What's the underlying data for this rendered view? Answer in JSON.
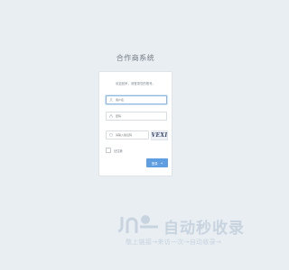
{
  "app": {
    "title": "合作商系统"
  },
  "login": {
    "welcome": "欢迎回来，请登录您的账号。",
    "username_placeholder": "用户名",
    "password_placeholder": "密码",
    "captcha_placeholder": "请输入验证码",
    "captcha_text": "VEXI",
    "remember_label": "记住我",
    "submit_label": "登录",
    "submit_arrow": "➜"
  },
  "icons": {
    "user": "user-icon",
    "lock": "lock-icon",
    "captcha": "shield-icon"
  },
  "colors": {
    "background": "#e9eef2",
    "primary": "#5f9ee0",
    "watermark": "#9fb4c8"
  },
  "watermark": {
    "brand": "自动秒收录",
    "tagline": "敬上链接→来访一次→自动收录→"
  }
}
